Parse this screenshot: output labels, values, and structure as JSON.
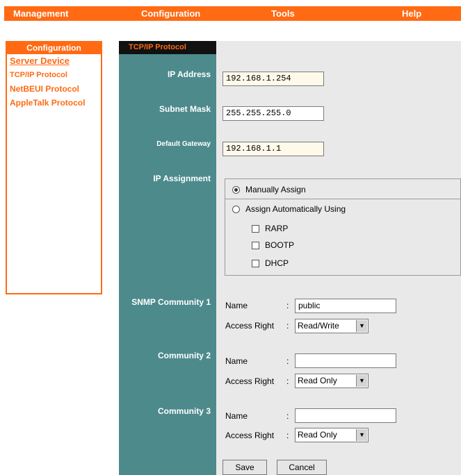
{
  "topnav": {
    "management": "Management",
    "configuration": "Configuration",
    "tools": "Tools",
    "help": "Help"
  },
  "sidebar": {
    "header": "Configuration",
    "items": [
      {
        "label": "Server Device"
      },
      {
        "label": "TCP/IP Protocol"
      },
      {
        "label": "NetBEUI Protocol"
      },
      {
        "label": "AppleTalk Protocol"
      }
    ]
  },
  "panel": {
    "tab_title": "TCP/IP Protocol",
    "ip_address_label": "IP Address",
    "ip_address_value": "192.168.1.254",
    "subnet_mask_label": "Subnet Mask",
    "subnet_mask_value": "255.255.255.0",
    "default_gateway_label": "Default Gateway",
    "default_gateway_value": "192.168.1.1",
    "ip_assignment_label": "IP Assignment",
    "manual_assign_label": "Manually Assign",
    "auto_assign_label": "Assign Automatically Using",
    "rarp_label": "RARP",
    "bootp_label": "BOOTP",
    "dhcp_label": "DHCP",
    "snmp1_label": "SNMP Community 1",
    "snmp2_label": "Community 2",
    "snmp3_label": "Community 3",
    "name_label": "Name",
    "access_right_label": "Access Right",
    "snmp1_name_value": "public",
    "snmp1_access_value": "Read/Write",
    "snmp2_name_value": "",
    "snmp2_access_value": "Read Only",
    "snmp3_name_value": "",
    "snmp3_access_value": "Read Only",
    "save_label": "Save",
    "cancel_label": "Cancel"
  },
  "colors": {
    "accent": "#ff6a13",
    "label_column": "#4d8a8c"
  }
}
